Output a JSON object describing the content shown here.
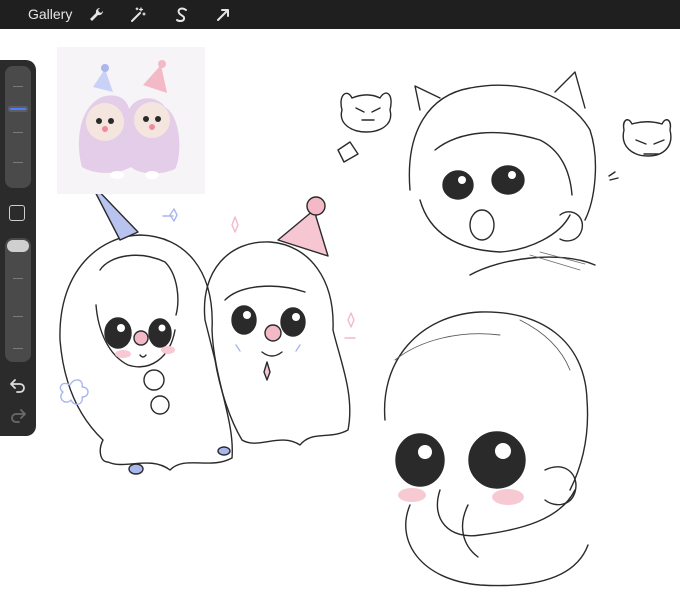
{
  "topbar": {
    "gallery_label": "Gallery",
    "tools": [
      {
        "name": "wrench-icon"
      },
      {
        "name": "magic-wand-icon"
      },
      {
        "name": "selection-icon"
      },
      {
        "name": "transform-arrow-icon"
      }
    ]
  },
  "sidebar": {
    "brush_size_level": 0.28,
    "opacity_level": 1.0,
    "buttons": [
      "modify-button",
      "undo-button",
      "redo-button"
    ]
  },
  "colors": {
    "topbar": "#1f1f1f",
    "sidebar": "#2b2b2b",
    "accent": "#4f7dff",
    "pink": "#f3b9c6",
    "lavender": "#b9c3f0"
  }
}
